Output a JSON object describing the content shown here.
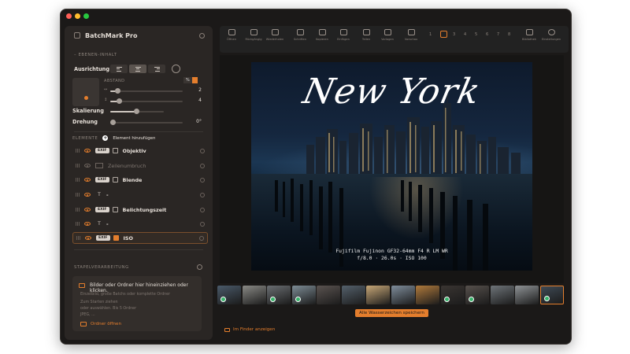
{
  "app": {
    "title": "BatchMark Pro"
  },
  "colors": {
    "accent": "#e47e2d",
    "sidebar_bg": "#2a2624",
    "window_bg": "#1b1918",
    "check_green": "#38b26a"
  },
  "sidebar": {
    "layer_content_label": "– EBENEN-INHALT",
    "alignment_label": "Ausrichtung",
    "alignment_options": [
      "left",
      "center",
      "right"
    ],
    "alignment_selected": "center",
    "spacing_label": "ABSTAND",
    "spacing_unit": "%",
    "spacing_x_label": "↔",
    "spacing_x_value": "2",
    "spacing_y_label": "↕",
    "spacing_y_value": "4",
    "scale_label": "Skalierung",
    "rotation_label": "Drehung",
    "rotation_value": "0°",
    "elements_label": "ELEMENTE",
    "add_element_label": "Element hinzufügen",
    "elements": [
      {
        "type_badge": "EXIF",
        "name": "Objektiv",
        "visible": true,
        "checked": false,
        "muted": false
      },
      {
        "type_badge": "",
        "name": "Zeilenumbruch",
        "visible": false,
        "checked": false,
        "muted": true
      },
      {
        "type_badge": "EXIF",
        "name": "Blende",
        "visible": true,
        "checked": false,
        "muted": false
      },
      {
        "type_badge": "T",
        "name": "-",
        "visible": true,
        "checked": false,
        "muted": false
      },
      {
        "type_badge": "EXIF",
        "name": "Belichtungszeit",
        "visible": true,
        "checked": false,
        "muted": false
      },
      {
        "type_badge": "T",
        "name": "-",
        "visible": true,
        "checked": false,
        "muted": false
      },
      {
        "type_badge": "EXIF",
        "name": "ISO",
        "visible": true,
        "checked": true,
        "muted": false,
        "selected": true
      }
    ],
    "stack_label": "STAPELVERARBEITUNG",
    "drop_title": "Bilder oder Ordner hier hineinziehen oder klicken.",
    "drop_sub1": "Einzelbild, große Batchs oder komplette Ordner",
    "drop_sub2": "Zum Starten ziehen",
    "drop_sub3": "oder auswählen. Bis 5 Ordner",
    "drop_sub4": "JPEG, ...",
    "open_folder_label": "Ordner öffnen"
  },
  "toolbar": {
    "items": [
      "Öffnen",
      "Rückgängig",
      "Wiederholen",
      "Schriften",
      "Kopieren",
      "Einfügen",
      "Teilen",
      "Vorlagen",
      "Vorschau"
    ],
    "numbers": [
      "1",
      "2",
      "3",
      "4",
      "5",
      "6",
      "7",
      "8"
    ],
    "active_number": "2",
    "right_items": [
      "Bibliothek",
      "Einstellungen"
    ]
  },
  "preview": {
    "watermark_title": "New York",
    "caption_line1": "Fujifilm Fujinon GF32-64mm F4 R LM WR",
    "caption_line2": "f/8.0 · 26.0s · ISO 100"
  },
  "filmstrip": {
    "thumb_count": 14,
    "checked_indices": [
      0,
      2,
      3,
      9,
      10,
      13
    ],
    "selected_index": 13,
    "save_all_label": "Alle Wasserzeichen speichern"
  },
  "footer": {
    "show_in_finder": "Im Finder anzeigen"
  }
}
